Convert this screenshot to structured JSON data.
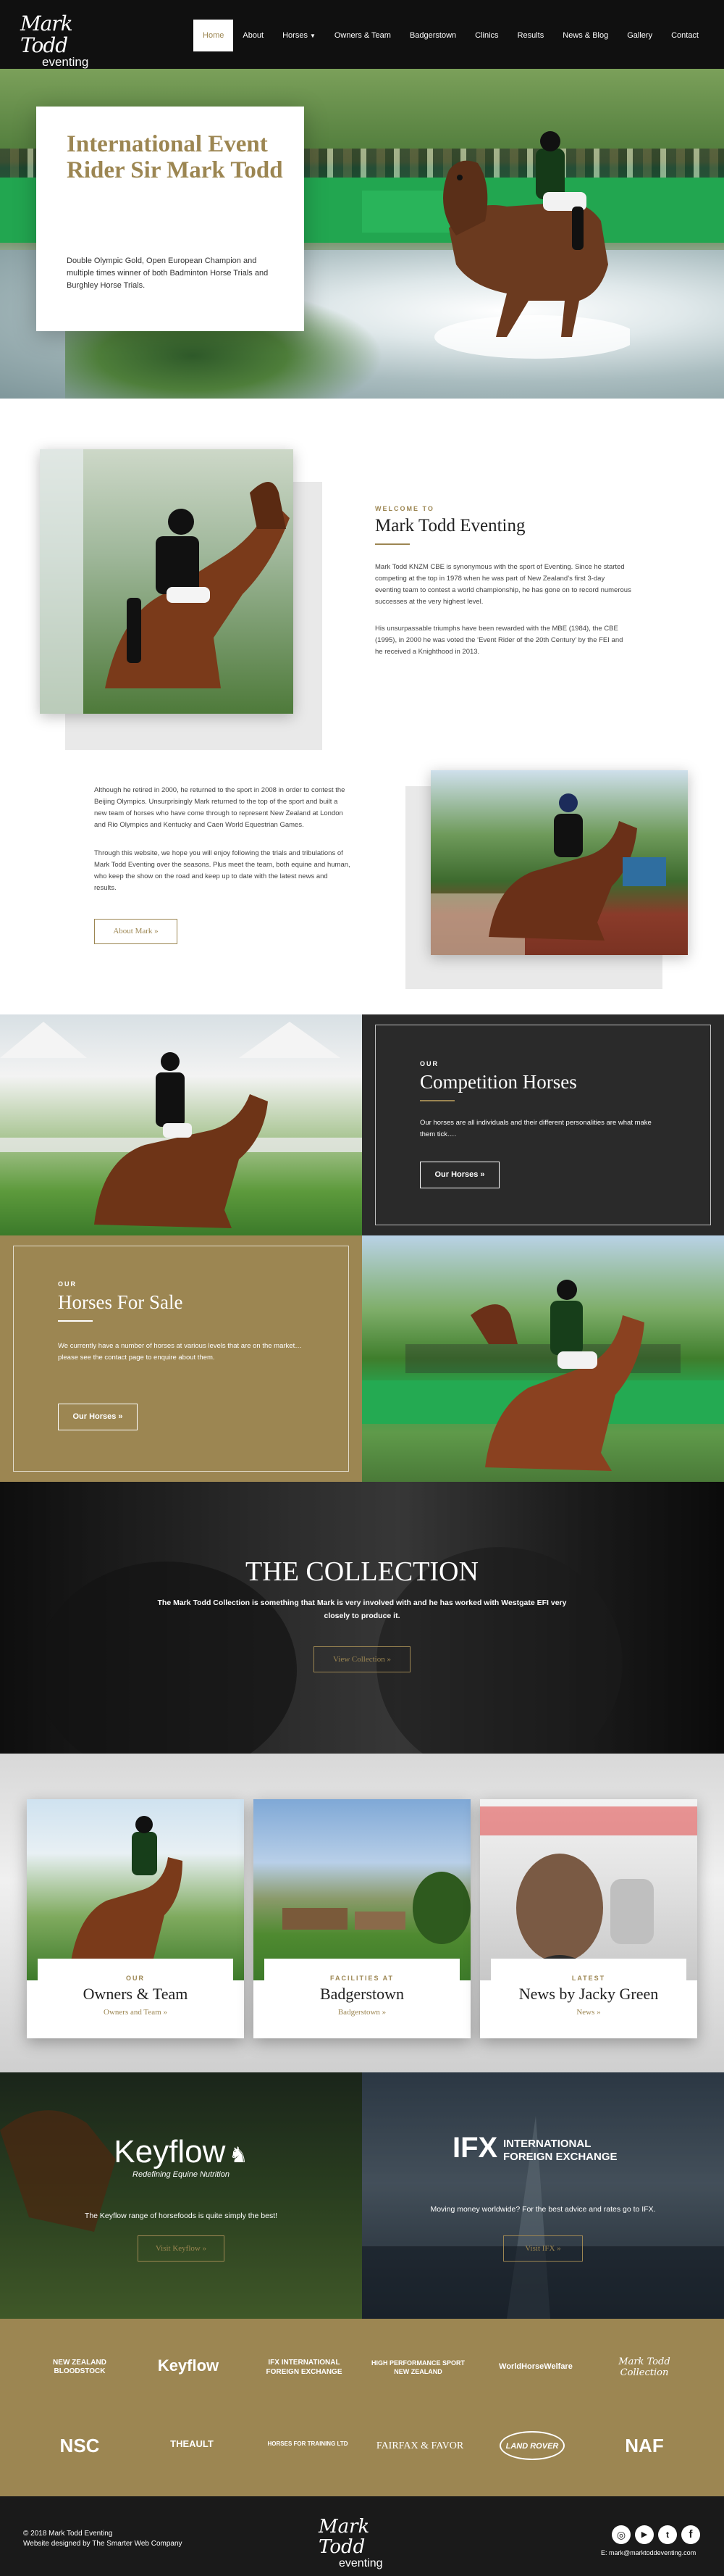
{
  "header": {
    "logo_script": "Mark Todd",
    "logo_sub": "eventing",
    "nav": [
      {
        "label": "Home",
        "active": true
      },
      {
        "label": "About"
      },
      {
        "label": "Horses",
        "has_caret": true
      },
      {
        "label": "Owners & Team"
      },
      {
        "label": "Badgerstown"
      },
      {
        "label": "Clinics"
      },
      {
        "label": "Results"
      },
      {
        "label": "News & Blog"
      },
      {
        "label": "Gallery"
      },
      {
        "label": "Contact"
      }
    ]
  },
  "hero": {
    "title": "International Event Rider Sir Mark Todd",
    "text": "Double Olympic Gold, Open European Champion and multiple times winner of both Badminton Horse Trials and Burghley Horse Trials."
  },
  "intro": {
    "kicker": "Welcome to",
    "heading": "Mark Todd Eventing",
    "para1": "Mark Todd KNZM CBE is synonymous with the sport of Eventing. Since he started competing at the top in 1978 when he was part of New Zealand’s first 3-day eventing team to contest a world championship, he has gone on to record numerous successes at the very highest level.",
    "para2": "His unsurpassable triumphs have been rewarded with the MBE (1984), the CBE (1995), in 2000 he was voted the ‘Event Rider of the 20th Century’ by the FEI and he received a Knighthood in 2013.",
    "para3": "Although he retired in 2000, he returned to the sport in 2008 in order to contest the Beijing Olympics. Unsurprisingly Mark returned to the top of the sport and built a new team of horses who have come through to represent New Zealand at London and Rio Olympics and Kentucky and Caen World Equestrian Games.",
    "para4": "Through this website, we hope you will enjoy following the trials and tribulations of Mark Todd Eventing over the seasons. Plus meet the team, both equine and human, who keep the show on the road and keep up to date with the latest news and results.",
    "button": "About Mark »"
  },
  "competition": {
    "kicker": "Our",
    "heading": "Competition Horses",
    "text": "Our horses are all individuals and their different personalities are what make them tick….",
    "button": "Our Horses »"
  },
  "for_sale": {
    "kicker": "Our",
    "heading": "Horses For Sale",
    "text": "We currently have a number of horses at various levels that are on the market… please see the contact page to enquire about them.",
    "button": "Our Horses »"
  },
  "collection": {
    "heading": "THE COLLECTION",
    "text": "The Mark Todd Collection is something that Mark is very involved with and he has worked with Westgate EFI very closely to produce it.",
    "button": "View Collection »"
  },
  "cards": [
    {
      "kicker": "Our",
      "title": "Owners & Team",
      "link": "Owners and Team »"
    },
    {
      "kicker": "Facilities at",
      "title": "Badgerstown",
      "link": "Badgerstown »"
    },
    {
      "kicker": "Latest",
      "title": "News by Jacky Green",
      "link": "News »"
    }
  ],
  "sponsors": {
    "keyflow": {
      "logo": "Keyflow",
      "tagline": "Redefining Equine Nutrition",
      "text": "The Keyflow range of horsefoods is quite simply the best!",
      "button": "Visit Keyflow »"
    },
    "ifx": {
      "logo": "IFX",
      "logo_line1": "INTERNATIONAL",
      "logo_line2": "FOREIGN EXCHANGE",
      "text": "Moving money worldwide? For the best advice and rates go to IFX.",
      "button": "Visit IFX »"
    }
  },
  "partners": [
    "NEW ZEALAND BLOODSTOCK",
    "Keyflow",
    "IFX INTERNATIONAL FOREIGN EXCHANGE",
    "HIGH PERFORMANCE SPORT NEW ZEALAND",
    "WorldHorseWelfare",
    "Mark Todd Collection",
    "NSC",
    "THEAULT",
    "HORSES FOR TRAINING LTD",
    "FAIRFAX & FAVOR",
    "LAND ROVER",
    "NAF"
  ],
  "footer": {
    "copyright": "© 2018 Mark Todd Eventing",
    "designed": "Website designed by The Smarter Web Company",
    "logo_script": "Mark Todd",
    "logo_sub": "eventing",
    "email": "E: mark@marktoddeventing.com",
    "social_icons": [
      "instagram-icon",
      "youtube-icon",
      "twitter-icon",
      "facebook-icon"
    ]
  },
  "colors": {
    "gold": "#9c8652",
    "dark": "#222222",
    "footer": "#1a1a1a"
  }
}
